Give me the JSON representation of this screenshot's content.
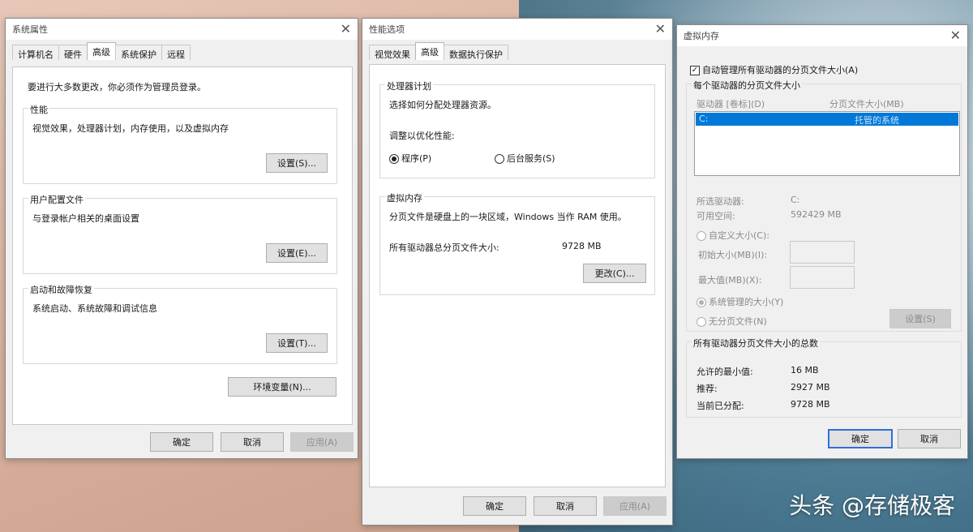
{
  "sysprops": {
    "title": "系统属性",
    "tabs": [
      "计算机名",
      "硬件",
      "高级",
      "系统保护",
      "远程"
    ],
    "admin_note": "要进行大多数更改，你必须作为管理员登录。",
    "perf": {
      "label": "性能",
      "desc": "视觉效果，处理器计划，内存使用，以及虚拟内存",
      "button": "设置(S)..."
    },
    "profile": {
      "label": "用户配置文件",
      "desc": "与登录帐户相关的桌面设置",
      "button": "设置(E)..."
    },
    "startup": {
      "label": "启动和故障恢复",
      "desc": "系统启动、系统故障和调试信息",
      "button": "设置(T)..."
    },
    "env_button": "环境变量(N)...",
    "ok": "确定",
    "cancel": "取消",
    "apply": "应用(A)"
  },
  "perfopts": {
    "title": "性能选项",
    "tabs": [
      "视觉效果",
      "高级",
      "数据执行保护"
    ],
    "sched": {
      "label": "处理器计划",
      "desc": "选择如何分配处理器资源。",
      "adjust": "调整以优化性能:",
      "opt_programs": "程序(P)",
      "opt_services": "后台服务(S)"
    },
    "vm": {
      "label": "虚拟内存",
      "desc": "分页文件是硬盘上的一块区域，Windows 当作 RAM 使用。",
      "total_label": "所有驱动器总分页文件大小:",
      "total_value": "9728 MB",
      "change_button": "更改(C)..."
    },
    "ok": "确定",
    "cancel": "取消",
    "apply": "应用(A)"
  },
  "vmem": {
    "title": "虚拟内存",
    "auto_manage": "自动管理所有驱动器的分页文件大小(A)",
    "per_drive_label": "每个驱动器的分页文件大小",
    "col_drive": "驱动器 [卷标](D)",
    "col_size": "分页文件大小(MB)",
    "row_drive": "C:",
    "row_size": "托管的系统",
    "selected_drive_label": "所选驱动器:",
    "selected_drive_value": "C:",
    "free_space_label": "可用空间:",
    "free_space_value": "592429 MB",
    "custom_size": "自定义大小(C):",
    "initial_size": "初始大小(MB)(I):",
    "max_size": "最大值(MB)(X):",
    "system_managed": "系统管理的大小(Y)",
    "no_paging": "无分页文件(N)",
    "set_button": "设置(S)",
    "totals_label": "所有驱动器分页文件大小的总数",
    "min_label": "允许的最小值:",
    "min_value": "16 MB",
    "rec_label": "推荐:",
    "rec_value": "2927 MB",
    "cur_label": "当前已分配:",
    "cur_value": "9728 MB",
    "ok": "确定",
    "cancel": "取消"
  },
  "watermark": "头条 @存储极客"
}
